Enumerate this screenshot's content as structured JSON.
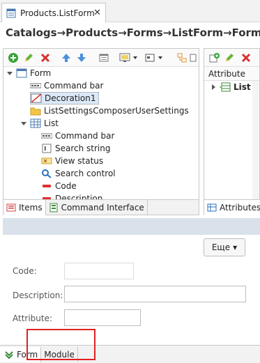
{
  "window": {
    "tab_title": "Products.ListForm",
    "close_glyph": "✕"
  },
  "breadcrumb": "Catalogs→Products→Forms→ListForm→Form",
  "left_tree": {
    "nodes": [
      {
        "label": "Form",
        "icon": "form-icon"
      },
      {
        "label": "Command bar",
        "icon": "command-bar-icon"
      },
      {
        "label": "Decoration1",
        "icon": "decoration-icon"
      },
      {
        "label": "ListSettingsComposerUserSettings",
        "icon": "folder-icon"
      },
      {
        "label": "List",
        "icon": "table-icon"
      },
      {
        "label": "Command bar",
        "icon": "command-bar-icon"
      },
      {
        "label": "Search string",
        "icon": "search-string-icon"
      },
      {
        "label": "View status",
        "icon": "view-status-icon"
      },
      {
        "label": "Search control",
        "icon": "search-control-icon"
      },
      {
        "label": "Code",
        "icon": "field-icon"
      },
      {
        "label": "Description",
        "icon": "field-icon"
      }
    ],
    "tabs": {
      "items": "Items",
      "command_interface": "Command Interface"
    }
  },
  "right_pane": {
    "column_header": "Attribute",
    "row_label": "List",
    "tab": "Attributes"
  },
  "preview": {
    "more_button": "Еще",
    "more_arrow": "▾",
    "fields": {
      "code": "Code:",
      "description": "Description:",
      "attribute": "Attribute:"
    }
  },
  "bottom_tabs": {
    "form": "Form",
    "module": "Module"
  },
  "colors": {
    "accent": "#4a90d9",
    "highlight_box": "#e02020",
    "preview_strip": "#d9e2ea"
  }
}
